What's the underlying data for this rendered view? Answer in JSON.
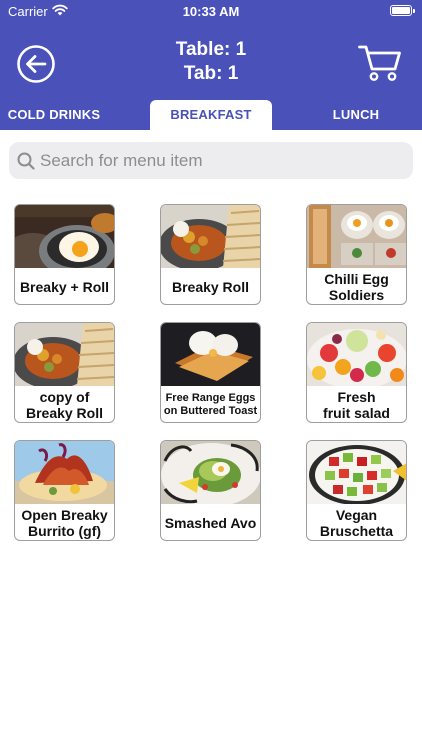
{
  "status_bar": {
    "carrier": "Carrier",
    "time": "10:33 AM"
  },
  "header": {
    "title_line1": "Table: 1",
    "title_line2": "Tab: 1",
    "back_icon": "back-arrow-circle-icon",
    "cart_icon": "shopping-cart-icon",
    "background_color": "#4a51b8"
  },
  "tabs": [
    {
      "label": "COLD DRINKS",
      "selected": false
    },
    {
      "label": "BREAKFAST",
      "selected": true
    },
    {
      "label": "LUNCH",
      "selected": false
    }
  ],
  "search": {
    "placeholder": "Search for menu item",
    "value": ""
  },
  "menu_items": [
    {
      "label": "Breaky + Roll",
      "image": "fried-egg-potato-plate"
    },
    {
      "label": "Breaky Roll",
      "image": "potato-hash-with-roll"
    },
    {
      "label": "Chilli Egg\nSoldiers",
      "image": "toast-soldiers-jars"
    },
    {
      "label": "copy of\nBreaky Roll",
      "image": "potato-hash-with-roll"
    },
    {
      "label": "Free Range Eggs\non Buttered Toast",
      "image": "poached-eggs-toast"
    },
    {
      "label": "Fresh\nfruit salad",
      "image": "fruit-salad-bowl"
    },
    {
      "label": "Open Breaky\nBurrito (gf)",
      "image": "open-burrito-bacon"
    },
    {
      "label": "Smashed Avo",
      "image": "smashed-avocado-plate"
    },
    {
      "label": "Vegan\nBruschetta",
      "image": "vegan-bruschetta-bowl"
    }
  ]
}
